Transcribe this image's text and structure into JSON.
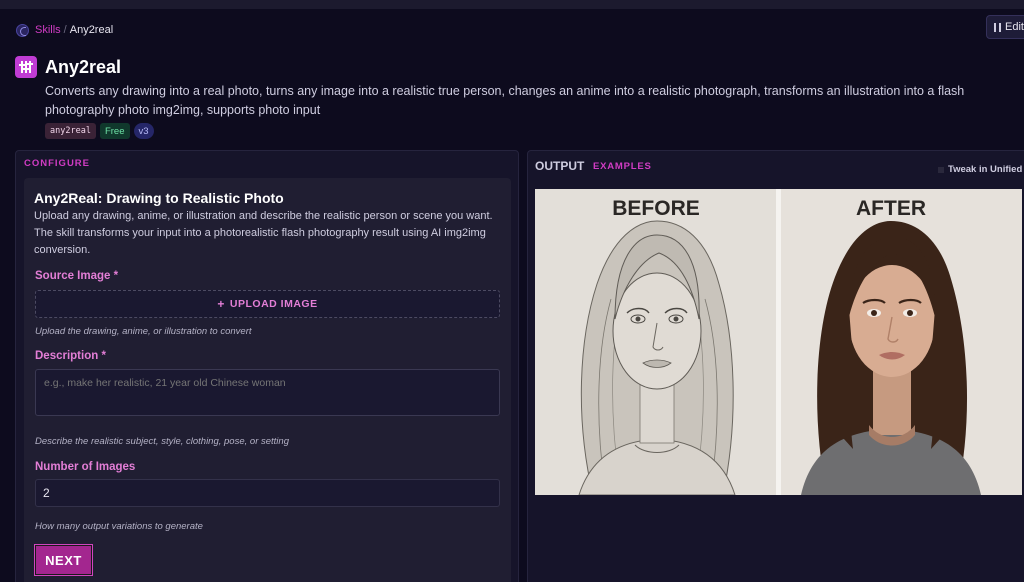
{
  "breadcrumb": {
    "parent": "Skills",
    "separator": "/",
    "current": "Any2real"
  },
  "header": {
    "edit_label": "Edit",
    "title": "Any2real",
    "description": "Converts any drawing into a real photo, turns any image into a realistic true person, changes an anime into a realistic photograph, transforms an illustration into a flash photography photo img2img, supports photo input",
    "tags": {
      "slug": "any2real",
      "price": "Free",
      "version": "v3"
    }
  },
  "configure": {
    "section_label": "CONFIGURE",
    "card_title": "Any2Real: Drawing to Realistic Photo",
    "card_description": "Upload any drawing, anime, or illustration and describe the realistic person or scene you want. The skill transforms your input into a photorealistic flash photography result using AI img2img conversion.",
    "source_image": {
      "label": "Source Image",
      "required": "*",
      "button_label": "UPLOAD IMAGE",
      "hint": "Upload the drawing, anime, or illustration to convert"
    },
    "description_field": {
      "label": "Description",
      "required": "*",
      "placeholder": "e.g., make her realistic, 21 year old Chinese woman",
      "hint": "Describe the realistic subject, style, clothing, pose, or setting"
    },
    "num_images": {
      "label": "Number of Images",
      "value": "2",
      "hint": "How many output variations to generate"
    },
    "next_label": "NEXT"
  },
  "output": {
    "title": "OUTPUT",
    "examples_label": "EXAMPLES",
    "tweak_label": "Tweak in Unified",
    "example": {
      "before_label": "BEFORE",
      "after_label": "AFTER"
    }
  },
  "colors": {
    "accent": "#d13cc4",
    "background": "#0d0b1e",
    "panel": "#16142a",
    "card": "#201e32",
    "free_tag": "#6ee0a6"
  }
}
